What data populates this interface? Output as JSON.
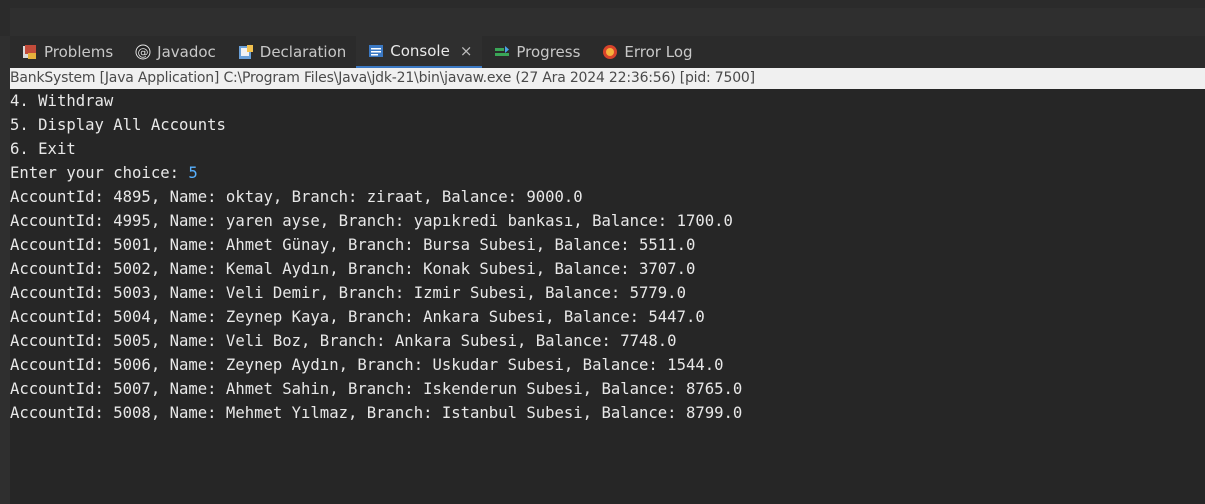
{
  "tabs": [
    {
      "label": "Problems",
      "icon": "problems-icon"
    },
    {
      "label": "Javadoc",
      "icon": "javadoc-icon"
    },
    {
      "label": "Declaration",
      "icon": "declaration-icon"
    },
    {
      "label": "Console",
      "icon": "console-icon",
      "active": true,
      "close": "×"
    },
    {
      "label": "Progress",
      "icon": "progress-icon"
    },
    {
      "label": "Error Log",
      "icon": "error-log-icon"
    }
  ],
  "launch_info": "BankSystem [Java Application] C:\\Program Files\\Java\\jdk-21\\bin\\javaw.exe  (27 Ara 2024 22:36:56) [pid: 7500]",
  "console": {
    "menu": [
      "4. Withdraw",
      "5. Display All Accounts",
      "6. Exit"
    ],
    "prompt": "Enter your choice: ",
    "user_input": "5",
    "accounts": [
      "AccountId: 4895, Name: oktay, Branch: ziraat, Balance: 9000.0",
      "AccountId: 4995, Name: yaren ayse, Branch: yapıkredi bankası, Balance: 1700.0",
      "AccountId: 5001, Name: Ahmet Günay, Branch: Bursa Subesi, Balance: 5511.0",
      "AccountId: 5002, Name: Kemal Aydın, Branch: Konak Subesi, Balance: 3707.0",
      "AccountId: 5003, Name: Veli Demir, Branch: Izmir Subesi, Balance: 5779.0",
      "AccountId: 5004, Name: Zeynep Kaya, Branch: Ankara Subesi, Balance: 5447.0",
      "AccountId: 5005, Name: Veli Boz, Branch: Ankara Subesi, Balance: 7748.0",
      "AccountId: 5006, Name: Zeynep Aydın, Branch: Uskudar Subesi, Balance: 1544.0",
      "AccountId: 5007, Name: Ahmet Sahin, Branch: Iskenderun Subesi, Balance: 8765.0",
      "AccountId: 5008, Name: Mehmet Yılmaz, Branch: Istanbul Subesi, Balance: 8799.0"
    ]
  },
  "colors": {
    "background": "#262626",
    "text": "#e8e8e8",
    "input": "#58b1ff",
    "active_tab_underline": "#3b79c4"
  }
}
